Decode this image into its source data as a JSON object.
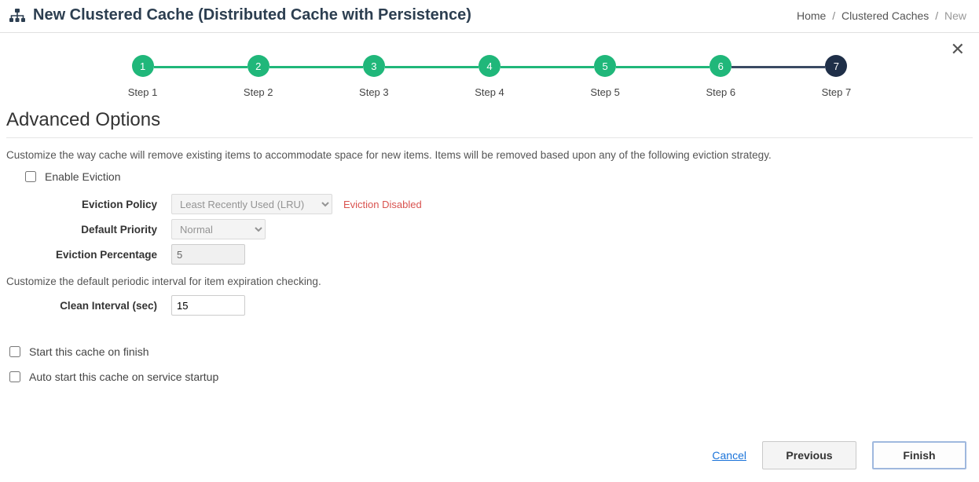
{
  "header": {
    "title": "New Clustered Cache (Distributed Cache with Persistence)",
    "breadcrumb": {
      "home": "Home",
      "section": "Clustered Caches",
      "current": "New"
    }
  },
  "stepper": {
    "steps": [
      {
        "num": "1",
        "label": "Step 1"
      },
      {
        "num": "2",
        "label": "Step 2"
      },
      {
        "num": "3",
        "label": "Step 3"
      },
      {
        "num": "4",
        "label": "Step 4"
      },
      {
        "num": "5",
        "label": "Step 5"
      },
      {
        "num": "6",
        "label": "Step 6"
      },
      {
        "num": "7",
        "label": "Step 7"
      }
    ]
  },
  "section": {
    "title": "Advanced Options",
    "eviction_desc": "Customize the way cache will remove existing items to accommodate space for new items. Items will be removed based upon any of the following eviction strategy.",
    "enable_eviction_label": "Enable Eviction",
    "eviction_policy_label": "Eviction Policy",
    "eviction_policy_value": "Least Recently Used (LRU)",
    "eviction_disabled_warn": "Eviction Disabled",
    "default_priority_label": "Default Priority",
    "default_priority_value": "Normal",
    "eviction_percentage_label": "Eviction Percentage",
    "eviction_percentage_value": "5",
    "clean_interval_desc": "Customize the default periodic interval for item expiration checking.",
    "clean_interval_label": "Clean Interval (sec)",
    "clean_interval_value": "15",
    "start_on_finish_label": "Start this cache on finish",
    "auto_start_label": "Auto start this cache on service startup"
  },
  "footer": {
    "cancel": "Cancel",
    "previous": "Previous",
    "finish": "Finish"
  }
}
